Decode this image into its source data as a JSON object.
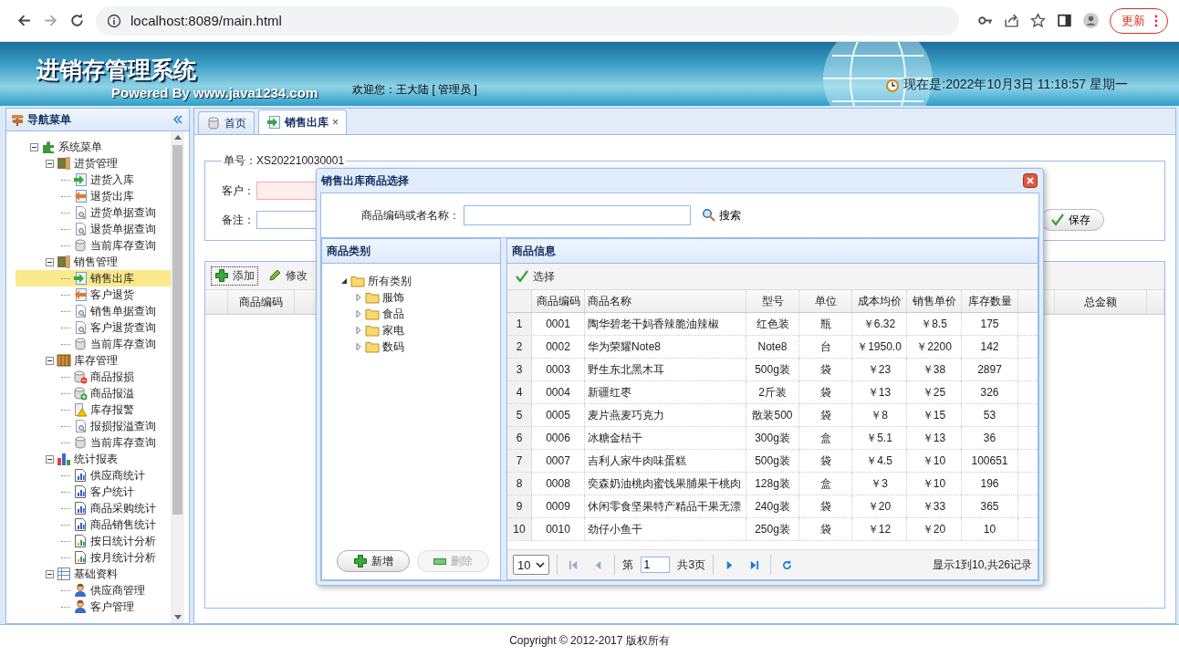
{
  "browser": {
    "url": "localhost:8089/main.html",
    "update_button": "更新"
  },
  "header": {
    "title": "进销存管理系统",
    "subtitle": "Powered By www.java1234.com",
    "welcome": "欢迎您：王大陆 [ 管理员 ]",
    "clock": "现在是:2022年10月3日 11:18:57 星期一"
  },
  "sidebar": {
    "title": "导航菜单",
    "tree": [
      {
        "label": "系统菜单",
        "kind": "puzzle",
        "expanded": true,
        "children": [
          {
            "label": "进货管理",
            "kind": "door",
            "expanded": true,
            "children": [
              {
                "label": "进货入库",
                "kind": "in",
                "selected": false
              },
              {
                "label": "退货出库",
                "kind": "out",
                "selected": false
              },
              {
                "label": "进货单据查询",
                "kind": "query",
                "selected": false
              },
              {
                "label": "退货单据查询",
                "kind": "query",
                "selected": false
              },
              {
                "label": "当前库存查询",
                "kind": "stock",
                "selected": false
              }
            ]
          },
          {
            "label": "销售管理",
            "kind": "door",
            "expanded": true,
            "children": [
              {
                "label": "销售出库",
                "kind": "in",
                "selected": true
              },
              {
                "label": "客户退货",
                "kind": "out",
                "selected": false
              },
              {
                "label": "销售单据查询",
                "kind": "query",
                "selected": false
              },
              {
                "label": "客户退货查询",
                "kind": "query",
                "selected": false
              },
              {
                "label": "当前库存查询",
                "kind": "stock",
                "selected": false
              }
            ]
          },
          {
            "label": "库存管理",
            "kind": "box",
            "expanded": true,
            "children": [
              {
                "label": "商品报损",
                "kind": "loss",
                "selected": false
              },
              {
                "label": "商品报溢",
                "kind": "overflow",
                "selected": false
              },
              {
                "label": "库存报警",
                "kind": "alarm",
                "selected": false
              },
              {
                "label": "报损报溢查询",
                "kind": "query",
                "selected": false
              },
              {
                "label": "当前库存查询",
                "kind": "stock",
                "selected": false
              }
            ]
          },
          {
            "label": "统计报表",
            "kind": "bars",
            "expanded": true,
            "children": [
              {
                "label": "供应商统计",
                "kind": "chart",
                "selected": false
              },
              {
                "label": "客户统计",
                "kind": "chart",
                "selected": false
              },
              {
                "label": "商品采购统计",
                "kind": "chart",
                "selected": false
              },
              {
                "label": "商品销售统计",
                "kind": "chart",
                "selected": false
              },
              {
                "label": "按日统计分析",
                "kind": "chart2",
                "selected": false
              },
              {
                "label": "按月统计分析",
                "kind": "chart2",
                "selected": false
              }
            ]
          },
          {
            "label": "基础资料",
            "kind": "table",
            "expanded": true,
            "children": [
              {
                "label": "供应商管理",
                "kind": "person",
                "selected": false
              },
              {
                "label": "客户管理",
                "kind": "person",
                "selected": false
              }
            ]
          }
        ]
      }
    ]
  },
  "tabs": [
    {
      "label": "首页",
      "kind": "stock",
      "selected": false
    },
    {
      "label": "销售出库",
      "kind": "in",
      "selected": true,
      "close": "×"
    }
  ],
  "form": {
    "legend": "单号：XS202210030001",
    "customer_label": "客户：",
    "customer_required": true,
    "note_label": "备注：",
    "save_button": "保存"
  },
  "grid": {
    "toolbar": [
      {
        "label": "添加",
        "kind": "add",
        "focused": true
      },
      {
        "label": "修改",
        "kind": "edit",
        "focused": false
      }
    ],
    "columns": [
      "商品编码",
      "总金额"
    ]
  },
  "dialog": {
    "title": "销售出库商品选择",
    "search_label": "商品编码或者名称：",
    "search_button": "搜索",
    "category_panel": {
      "title": "商品类别",
      "tree": [
        {
          "label": "所有类别",
          "expanded": true,
          "children": [
            {
              "label": "服饰",
              "expanded": false
            },
            {
              "label": "食品",
              "expanded": false
            },
            {
              "label": "家电",
              "expanded": false
            },
            {
              "label": "数码",
              "expanded": false
            }
          ]
        }
      ],
      "buttons": [
        {
          "label": "新增",
          "kind": "add",
          "disabled": false
        },
        {
          "label": "删除",
          "kind": "remove",
          "disabled": true
        }
      ]
    },
    "product_panel": {
      "title": "商品信息",
      "select_button": "选择",
      "columns": [
        "商品编码",
        "商品名称",
        "型号",
        "单位",
        "成本均价",
        "销售单价",
        "库存数量"
      ],
      "rows": [
        {
          "no": "1",
          "cells": [
            "0001",
            "陶华碧老干妈香辣脆油辣椒",
            "红色装",
            "瓶",
            "￥6.32",
            "￥8.5",
            "175"
          ]
        },
        {
          "no": "2",
          "cells": [
            "0002",
            "华为荣耀Note8",
            "Note8",
            "台",
            "￥1950.0",
            "￥2200",
            "142"
          ]
        },
        {
          "no": "3",
          "cells": [
            "0003",
            "野生东北黑木耳",
            "500g装",
            "袋",
            "￥23",
            "￥38",
            "2897"
          ]
        },
        {
          "no": "4",
          "cells": [
            "0004",
            "新疆红枣",
            "2斤装",
            "袋",
            "￥13",
            "￥25",
            "326"
          ]
        },
        {
          "no": "5",
          "cells": [
            "0005",
            "麦片燕麦巧克力",
            "散装500",
            "袋",
            "￥8",
            "￥15",
            "53"
          ]
        },
        {
          "no": "6",
          "cells": [
            "0006",
            "冰糖金桔干",
            "300g装",
            "盒",
            "￥5.1",
            "￥13",
            "36"
          ]
        },
        {
          "no": "7",
          "cells": [
            "0007",
            "吉利人家牛肉味蛋糕",
            "500g装",
            "袋",
            "￥4.5",
            "￥10",
            "100651"
          ]
        },
        {
          "no": "8",
          "cells": [
            "0008",
            "奕森奶油桃肉蜜饯果脯果干桃肉",
            "128g装",
            "盒",
            "￥3",
            "￥10",
            "196"
          ]
        },
        {
          "no": "9",
          "cells": [
            "0009",
            "休闲零食坚果特产精品干果无漂",
            "240g装",
            "袋",
            "￥20",
            "￥33",
            "365"
          ]
        },
        {
          "no": "10",
          "cells": [
            "0010",
            "劲仔小鱼干",
            "250g装",
            "袋",
            "￥12",
            "￥20",
            "10"
          ]
        }
      ],
      "pager": {
        "page_size": "10",
        "page_prefix": "第",
        "page": "1",
        "page_total": "共3页",
        "summary": "显示1到10,共26记录"
      }
    }
  },
  "footer": "Copyright © 2012-2017 版权所有"
}
